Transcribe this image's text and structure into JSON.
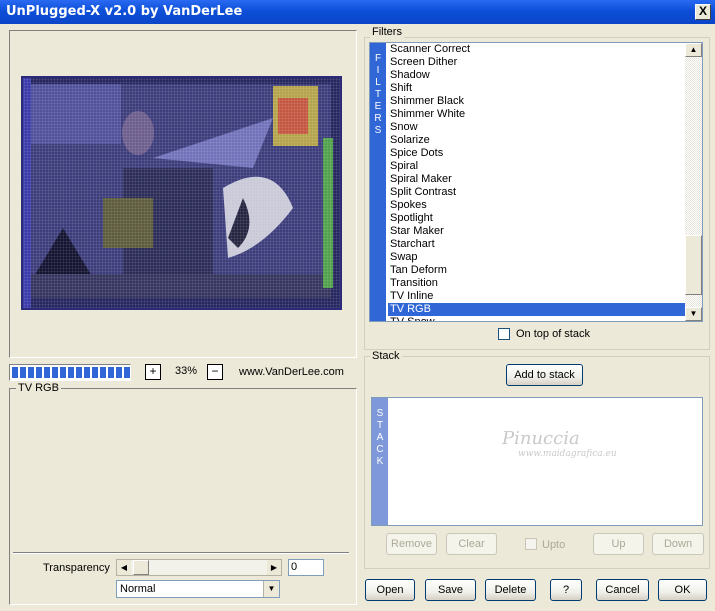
{
  "window": {
    "title": "UnPlugged-X v2.0 by VanDerLee",
    "close_label": "X"
  },
  "preview": {
    "progress_fraction": 1,
    "zoom_in_label": "+",
    "zoom_out_label": "−",
    "zoom_value": "33%",
    "website": "www.VanDerLee.com"
  },
  "params": {
    "filter_name": "TV RGB",
    "transparency_label": "Transparency",
    "transparency_value": "0",
    "blend_mode": "Normal"
  },
  "filters": {
    "group_label": "Filters",
    "side_letters": [
      "F",
      "I",
      "L",
      "T",
      "E",
      "R",
      "S"
    ],
    "items": [
      "Scanner Correct",
      "Screen Dither",
      "Shadow",
      "Shift",
      "Shimmer Black",
      "Shimmer White",
      "Snow",
      "Solarize",
      "Spice Dots",
      "Spiral",
      "Spiral Maker",
      "Split Contrast",
      "Spokes",
      "Spotlight",
      "Star Maker",
      "Starchart",
      "Swap",
      "Tan Deform",
      "Transition",
      "TV Inline",
      "TV RGB",
      "TV Snow"
    ],
    "selected_index": 20,
    "on_top_label": "On top of stack"
  },
  "stack": {
    "group_label": "Stack",
    "add_label": "Add to stack",
    "side_letters": [
      "S",
      "T",
      "A",
      "C",
      "K"
    ],
    "watermark_name": "Pinuccia",
    "watermark_url": "www.maidagrafica.eu",
    "remove_label": "Remove",
    "clear_label": "Clear",
    "upto_label": "Upto",
    "up_label": "Up",
    "down_label": "Down"
  },
  "footer": {
    "open_label": "Open",
    "save_label": "Save",
    "delete_label": "Delete",
    "help_label": "?",
    "cancel_label": "Cancel",
    "ok_label": "OK"
  },
  "colors": {
    "accent": "#3166D6",
    "titlebar": "#0D4FD8",
    "face": "#ECE9D8"
  }
}
